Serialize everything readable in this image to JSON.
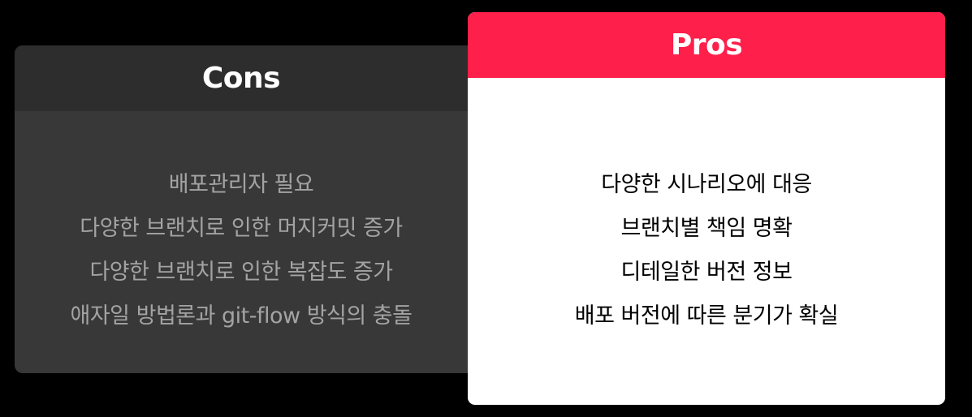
{
  "cons": {
    "title": "Cons",
    "items": [
      "배포관리자 필요",
      "다양한 브랜치로 인한 머지커밋 증가",
      "다양한 브랜치로 인한 복잡도 증가",
      "애자일 방법론과 git-flow 방식의 충돌"
    ]
  },
  "pros": {
    "title": "Pros",
    "items": [
      "다양한 시나리오에 대응",
      "브랜치별 책임 명확",
      "디테일한 버전 정보",
      "배포 버전에 따른 분기가 확실"
    ]
  },
  "colors": {
    "background": "#000000",
    "cons_card": "#383838",
    "cons_header": "#2d2d2d",
    "cons_text": "#a3a3a3",
    "pros_header": "#ff1f4b",
    "pros_card": "#ffffff",
    "pros_text": "#000000"
  }
}
